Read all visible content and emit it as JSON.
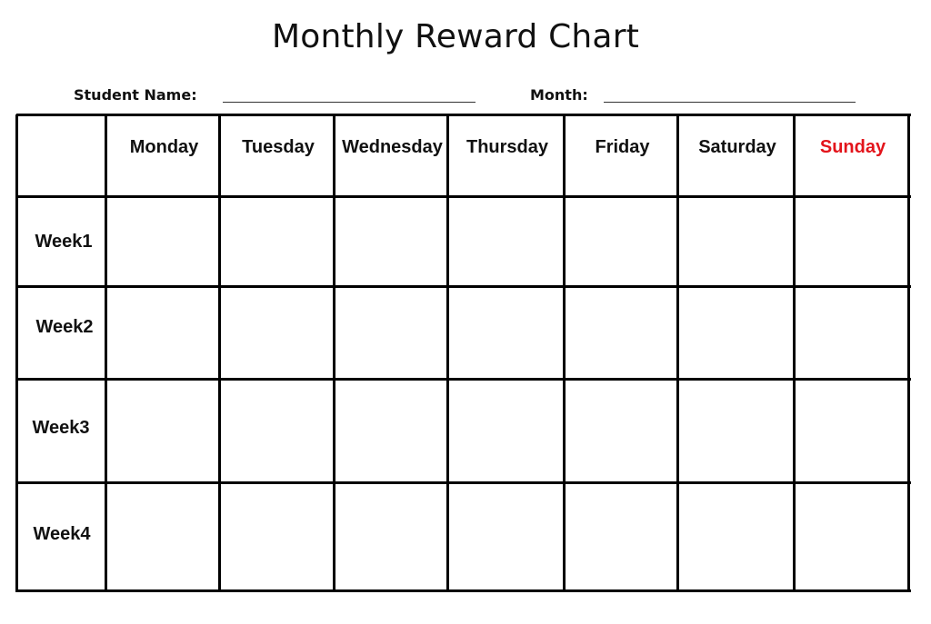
{
  "title": "Monthly Reward Chart",
  "fields": {
    "student_name_label": "Student Name:",
    "student_name_value": "",
    "month_label": "Month:",
    "month_value": ""
  },
  "table": {
    "corner_header": "",
    "days": [
      {
        "label": "Monday",
        "color": "#111111"
      },
      {
        "label": "Tuesday",
        "color": "#111111"
      },
      {
        "label": "Wednesday",
        "color": "#111111"
      },
      {
        "label": "Thursday",
        "color": "#111111"
      },
      {
        "label": "Friday",
        "color": "#111111"
      },
      {
        "label": "Saturday",
        "color": "#111111"
      },
      {
        "label": "Sunday",
        "color": "#e3141b"
      }
    ],
    "weeks": [
      {
        "label": "Week1",
        "cells": [
          "",
          "",
          "",
          "",
          "",
          "",
          ""
        ]
      },
      {
        "label": "Week2",
        "cells": [
          "",
          "",
          "",
          "",
          "",
          "",
          ""
        ]
      },
      {
        "label": "Week3",
        "cells": [
          "",
          "",
          "",
          "",
          "",
          "",
          ""
        ]
      },
      {
        "label": "Week4",
        "cells": [
          "",
          "",
          "",
          "",
          "",
          "",
          ""
        ]
      }
    ]
  },
  "colors": {
    "grid": "#000000",
    "text": "#111111",
    "weekend_accent": "#e3141b"
  }
}
